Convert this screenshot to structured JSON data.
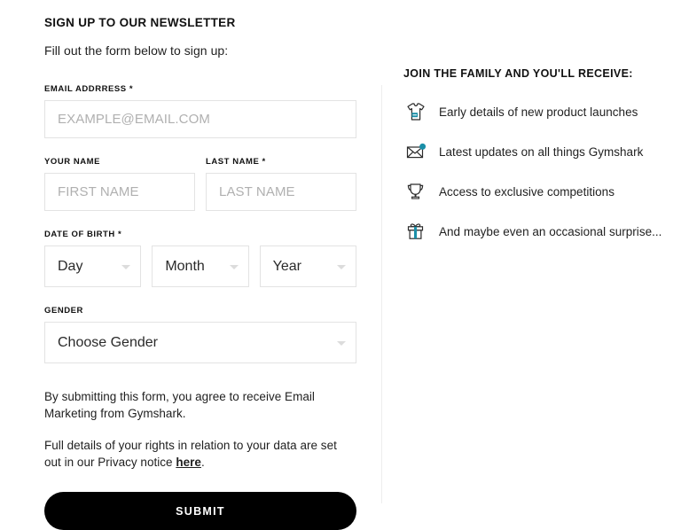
{
  "form": {
    "title": "SIGN UP TO OUR NEWSLETTER",
    "subtitle": "Fill out the form below to sign up:",
    "email": {
      "label": "EMAIL ADDRRESS *",
      "placeholder": "EXAMPLE@EMAIL.COM",
      "value": ""
    },
    "first_name": {
      "label": "YOUR NAME",
      "placeholder": "FIRST NAME",
      "value": ""
    },
    "last_name": {
      "label": "LAST NAME *",
      "placeholder": "LAST NAME",
      "value": ""
    },
    "dob": {
      "label": "DATE OF BIRTH *",
      "day": "Day",
      "month": "Month",
      "year": "Year"
    },
    "gender": {
      "label": "GENDER",
      "value": "Choose Gender"
    },
    "legal_1": "By submitting this form, you agree to receive Email Marketing from Gymshark.",
    "legal_2_before": "Full details of your rights in relation to your data are set out in our Privacy notice ",
    "legal_2_link": "here",
    "legal_2_after": ".",
    "submit_label": "SUBMIT"
  },
  "benefits": {
    "title": "JOIN THE FAMILY AND YOU'LL RECEIVE:",
    "items": [
      {
        "icon": "tshirt-icon",
        "text": "Early details of new product launches"
      },
      {
        "icon": "envelope-notification-icon",
        "text": "Latest updates on all things Gymshark"
      },
      {
        "icon": "trophy-icon",
        "text": "Access to exclusive competitions"
      },
      {
        "icon": "gift-icon",
        "text": "And maybe even an occasional surprise..."
      }
    ]
  },
  "colors": {
    "accent_teal": "#1a8fa8",
    "accent_light_teal": "#67c7d6",
    "button_bg": "#000000",
    "border": "#e3e3e3",
    "placeholder": "#b0b0b0"
  }
}
